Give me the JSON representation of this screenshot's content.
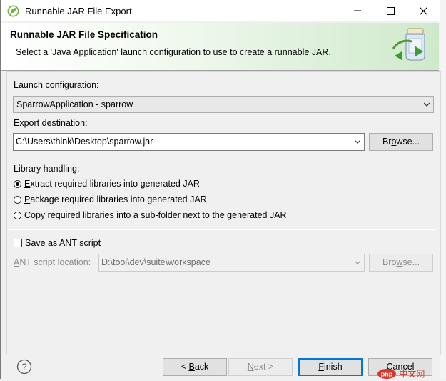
{
  "window": {
    "title": "Runnable JAR File Export",
    "icons": {
      "app": "spring-leaf-icon",
      "minimize": "minimize-icon",
      "maximize": "maximize-icon",
      "close": "close-icon"
    }
  },
  "header": {
    "title": "Runnable JAR File Specification",
    "message": "Select a 'Java Application' launch configuration to use to create a runnable JAR.",
    "icon": "jar-export-wizard-icon"
  },
  "launch": {
    "label_pre": "",
    "label_key": "L",
    "label_post": "aunch configuration:",
    "value": "SparrowApplication - sparrow"
  },
  "export": {
    "label_pre": "Export ",
    "label_key": "d",
    "label_post": "estination:",
    "value": "C:\\Users\\think\\Desktop\\sparrow.jar",
    "browse_pre": "Br",
    "browse_key": "o",
    "browse_post": "wse..."
  },
  "library": {
    "label": "Library handling:",
    "options": [
      {
        "key": "E",
        "rest": "xtract required libraries into generated JAR",
        "selected": true
      },
      {
        "key": "P",
        "rest": "ackage required libraries into generated JAR",
        "selected": false
      },
      {
        "key": "C",
        "rest": "opy required libraries into a sub-folder next to the generated JAR",
        "selected": false
      }
    ]
  },
  "ant": {
    "checkbox_key": "S",
    "checkbox_rest": "ave as ANT script",
    "checked": false,
    "location_key": "A",
    "location_rest": "NT script location:",
    "location_value": "D:\\tool\\dev\\suite\\workspace",
    "browse_pre": "Bro",
    "browse_key": "w",
    "browse_post": "se..."
  },
  "footer": {
    "help_icon": "help-icon",
    "back_pre": "< ",
    "back_key": "B",
    "back_post": "ack",
    "next_key": "N",
    "next_post": "ext >",
    "finish_key": "F",
    "finish_post": "inish",
    "cancel": "Cancel"
  },
  "watermark": "php 中文网",
  "colors": {
    "header_gradient_end": "#cfe9cb",
    "default_button_border": "#0078d7",
    "window_border": "#7a7a7a"
  }
}
